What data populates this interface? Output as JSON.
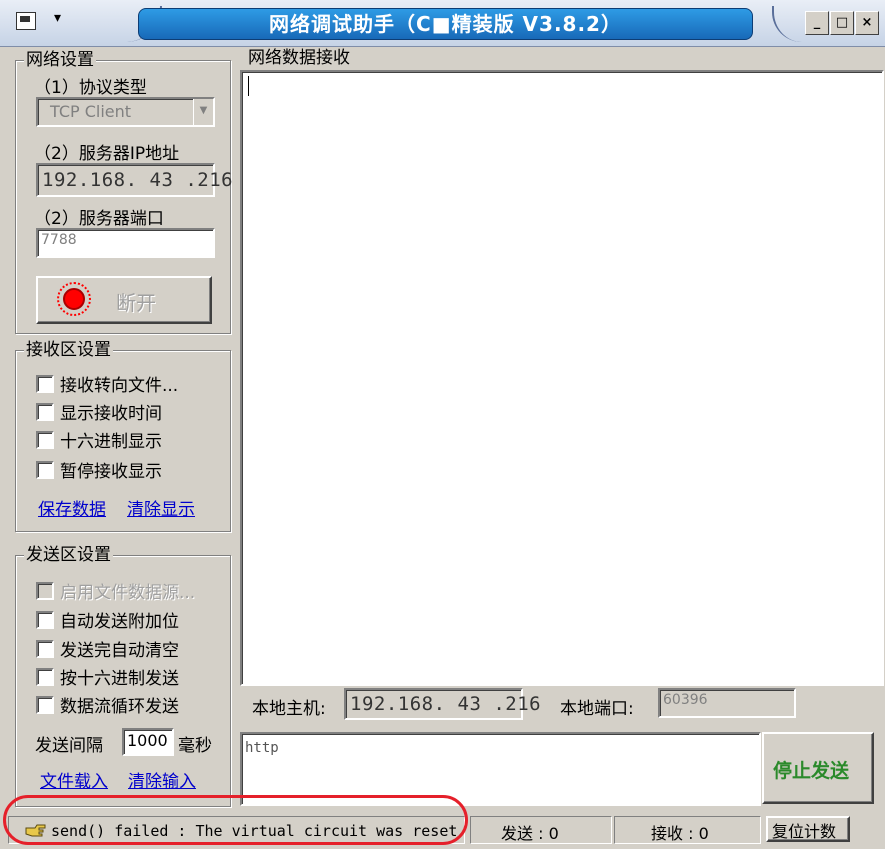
{
  "window": {
    "title": "网络调试助手（C■精装版 V3.8.2）",
    "buttons": {
      "minimize": "_",
      "maximize": "□",
      "close": "×"
    }
  },
  "network_settings": {
    "legend": "网络设置",
    "protocol_label": "（1）协议类型",
    "protocol_value": "TCP Client",
    "server_ip_label": "（2）服务器IP地址",
    "server_ip": [
      "192",
      "168",
      "43",
      "216"
    ],
    "server_port_label": "（2）服务器端口",
    "server_port": "7788",
    "connect_button": "断开"
  },
  "receive_settings": {
    "legend": "接收区设置",
    "options": [
      "接收转向文件...",
      "显示接收时间",
      "十六进制显示",
      "暂停接收显示"
    ],
    "save_link": "保存数据",
    "clear_link": "清除显示"
  },
  "send_settings": {
    "legend": "发送区设置",
    "file_source": "启用文件数据源...",
    "options": [
      "自动发送附加位",
      "发送完自动清空",
      "按十六进制发送",
      "数据流循环发送"
    ],
    "interval_label": "发送间隔",
    "interval_value": "1000",
    "interval_unit": "毫秒",
    "load_file_link": "文件载入",
    "clear_input_link": "清除输入"
  },
  "receive_area": {
    "legend": "网络数据接收",
    "content": ""
  },
  "local": {
    "host_label": "本地主机:",
    "host_ip": [
      "192",
      "168",
      "43",
      "216"
    ],
    "port_label": "本地端口:",
    "port_value": "60396"
  },
  "send_area": {
    "text": "http",
    "send_button": "停止发送"
  },
  "status": {
    "message": "send() failed : The virtual circuit was reset",
    "sent": "发送 : 0",
    "received": "接收 : 0",
    "reset_button": "复位计数"
  },
  "colors": {
    "window_bg": "#d4d0c8",
    "title_blue": "#1869b8",
    "send_button_text": "#2b8a2b",
    "link": "#0000cc",
    "annotation_red": "#e5202a"
  }
}
